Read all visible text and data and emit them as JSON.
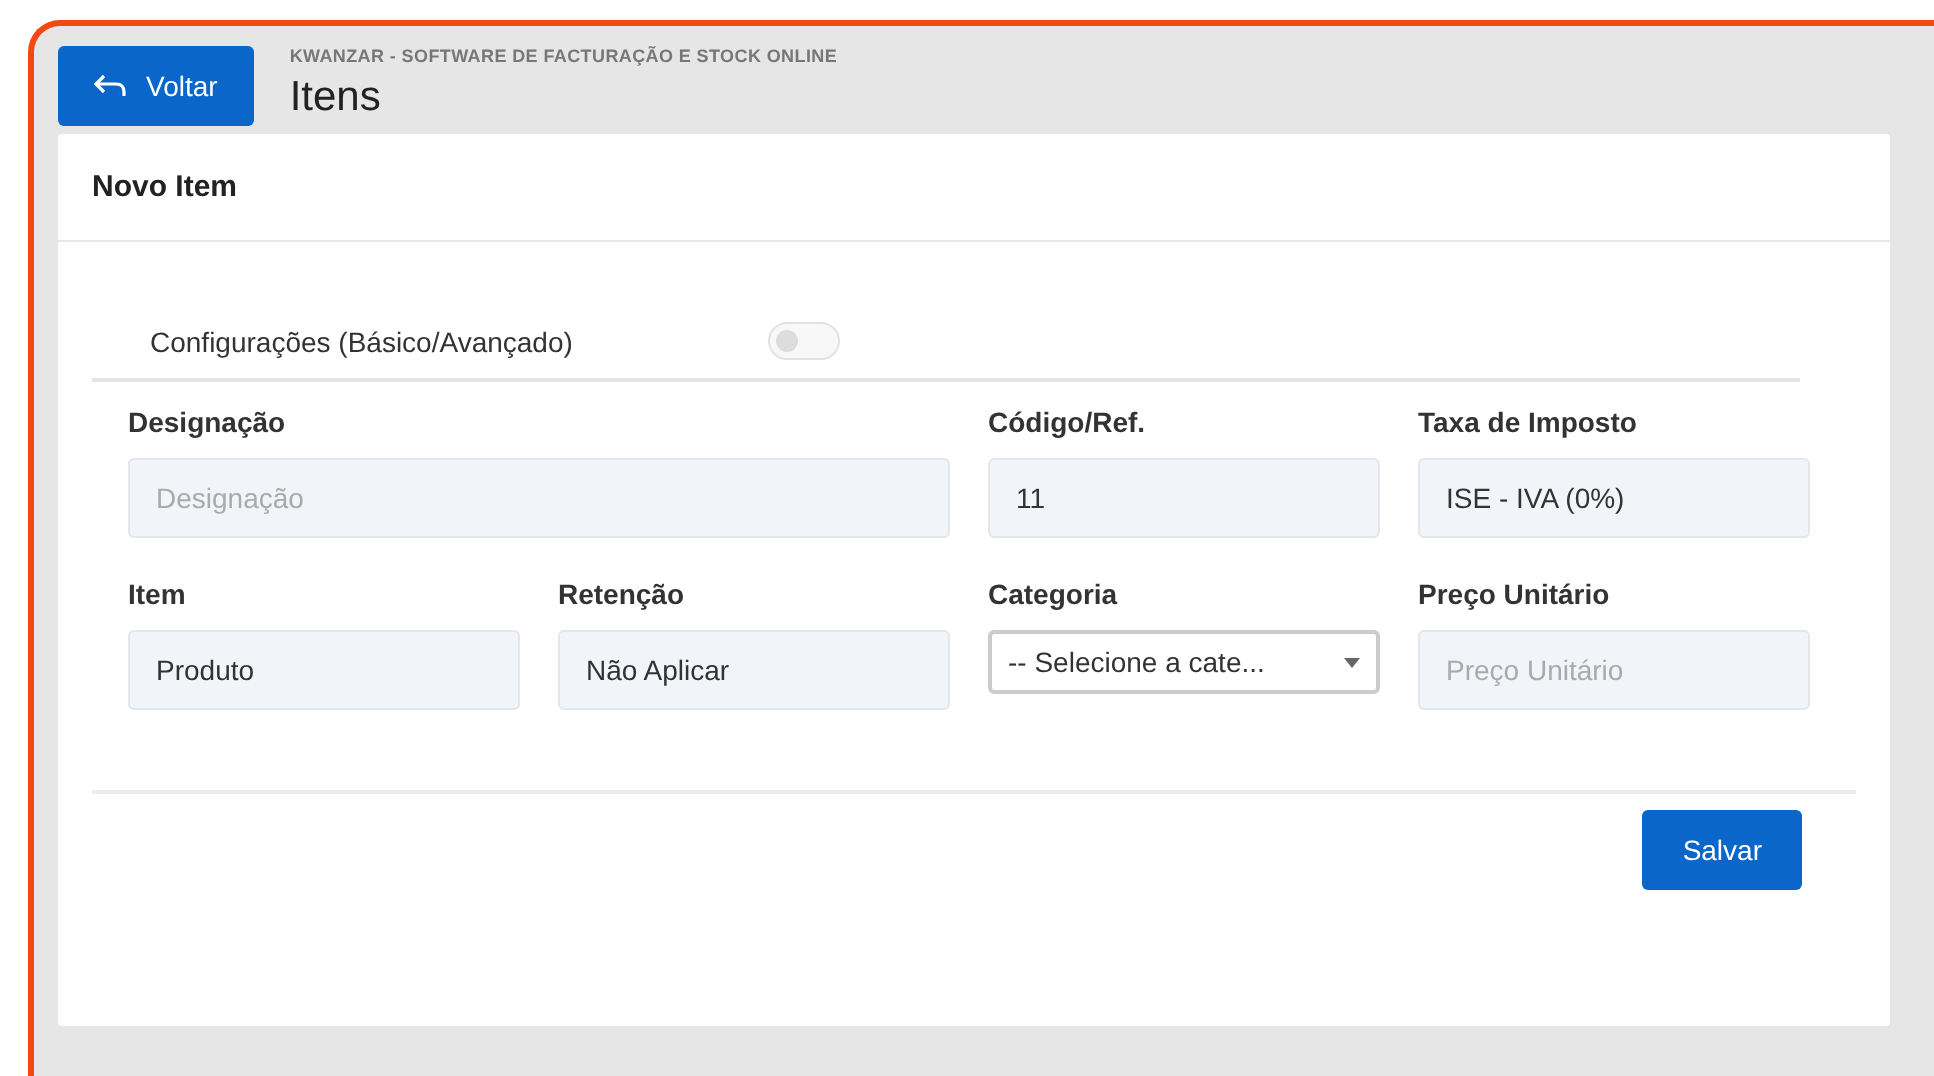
{
  "header": {
    "back_button": "Voltar",
    "app_name": "KWANZAR - SOFTWARE DE FACTURAÇÃO E STOCK ONLINE",
    "title": "Itens"
  },
  "card": {
    "title": "Novo Item",
    "settings_toggle": {
      "label": "Configurações (Básico/Avançado)",
      "on": false
    },
    "fields": [
      {
        "label": "Designação",
        "kind": "input",
        "placeholder": "Designação",
        "wide": true
      },
      {
        "label": "Código/Ref.",
        "kind": "input",
        "value": "11"
      },
      {
        "label": "Taxa de Imposto",
        "kind": "input",
        "value": "ISE - IVA (0%)"
      },
      {
        "label": "Item",
        "kind": "input",
        "value": "Produto"
      },
      {
        "label": "Retenção",
        "kind": "input",
        "value": "Não Aplicar"
      },
      {
        "label": "Categoria",
        "kind": "select",
        "value": "-- Selecione a cate..."
      },
      {
        "label": "Preço Unitário",
        "kind": "input",
        "placeholder": "Preço Unitário"
      }
    ],
    "save_button": "Salvar"
  }
}
